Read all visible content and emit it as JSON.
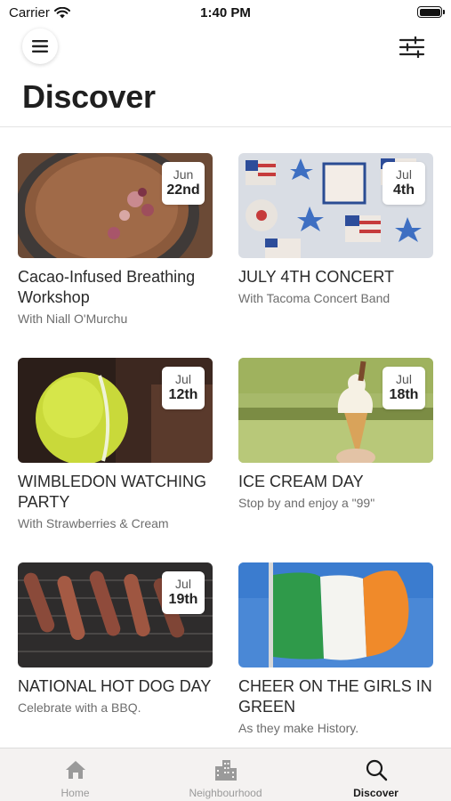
{
  "status_bar": {
    "carrier": "Carrier",
    "time": "1:40 PM"
  },
  "header": {
    "title": "Discover",
    "menu_icon": "hamburger-menu-icon",
    "filter_icon": "sliders-icon"
  },
  "events": [
    {
      "month": "Jun",
      "day": "22nd",
      "title": "Cacao-Infused Breathing Workshop",
      "subtitle": "With Niall O'Murchu",
      "image": "cacao-drink-photo"
    },
    {
      "month": "Jul",
      "day": "4th",
      "title": "JULY 4TH CONCERT",
      "subtitle": "With Tacoma Concert Band",
      "image": "july-4th-cookies-photo"
    },
    {
      "month": "Jul",
      "day": "12th",
      "title": "WIMBLEDON WATCHING PARTY",
      "subtitle": "With Strawberries & Cream",
      "image": "tennis-ball-photo"
    },
    {
      "month": "Jul",
      "day": "18th",
      "title": "ICE CREAM DAY",
      "subtitle": "Stop by and enjoy a \"99\"",
      "image": "ice-cream-cone-photo"
    },
    {
      "month": "Jul",
      "day": "19th",
      "title": "NATIONAL HOT DOG DAY",
      "subtitle": "Celebrate with a BBQ.",
      "image": "sausages-grill-photo"
    },
    {
      "month": "",
      "day": "",
      "title": "CHEER ON THE GIRLS IN GREEN",
      "subtitle": "As they make History.",
      "image": "irish-flag-photo"
    }
  ],
  "tabs": [
    {
      "label": "Home",
      "icon": "home-icon",
      "active": false
    },
    {
      "label": "Neighbourhood",
      "icon": "buildings-icon",
      "active": false
    },
    {
      "label": "Discover",
      "icon": "search-icon",
      "active": true
    }
  ],
  "colors": {
    "active_tab": "#1a1a1a",
    "inactive_tab": "#9a9a9a",
    "title": "#1f1f1f"
  }
}
